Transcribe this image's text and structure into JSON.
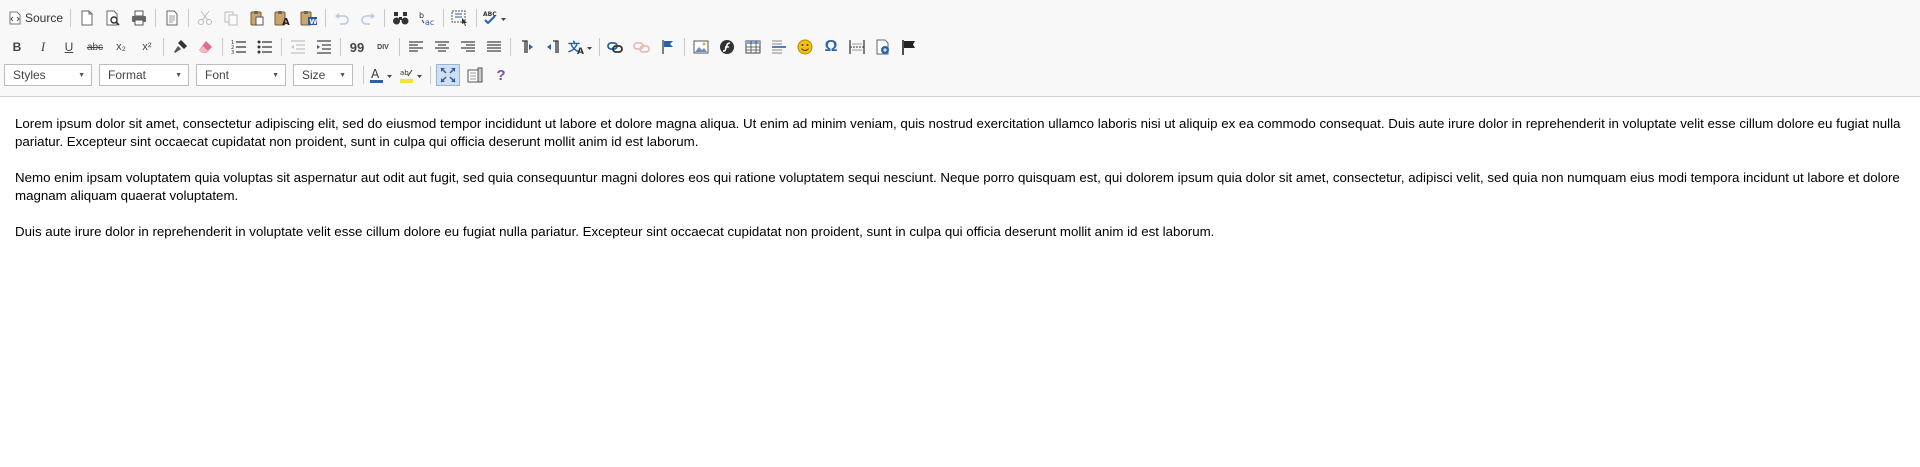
{
  "toolbar": {
    "source_label": "Source",
    "combos": {
      "styles": "Styles",
      "format": "Format",
      "font": "Font",
      "size": "Size"
    },
    "glyphs": {
      "bold": "B",
      "italic": "I",
      "underline": "U",
      "strike": "abc",
      "subscript": "x₂",
      "superscript": "x²",
      "blockquote": "99",
      "div": "DIV",
      "omega": "Ω",
      "help": "?"
    },
    "colors": {
      "accent": "#2b61a6",
      "text_color_swatch": "#2b61a6",
      "highlight_swatch": "#f3e23a",
      "flag": "#222222"
    }
  },
  "content": {
    "paragraphs": [
      "Lorem ipsum dolor sit amet, consectetur adipiscing elit, sed do eiusmod tempor incididunt ut labore et dolore magna aliqua. Ut enim ad minim veniam, quis nostrud exercitation ullamco laboris nisi ut aliquip ex ea commodo consequat. Duis aute irure dolor in reprehenderit in voluptate velit esse cillum dolore eu fugiat nulla pariatur. Excepteur sint occaecat cupidatat non proident, sunt in culpa qui officia deserunt mollit anim id est laborum.",
      "Nemo enim ipsam voluptatem quia voluptas sit aspernatur aut odit aut fugit, sed quia consequuntur magni dolores eos qui ratione voluptatem sequi nesciunt. Neque porro quisquam est, qui dolorem ipsum quia dolor sit amet, consectetur, adipisci velit, sed quia non numquam eius modi tempora incidunt ut labore et dolore magnam aliquam quaerat voluptatem.",
      "Duis aute irure dolor in reprehenderit in voluptate velit esse cillum dolore eu fugiat nulla pariatur. Excepteur sint occaecat cupidatat non proident, sunt in culpa qui officia deserunt mollit anim id est laborum."
    ]
  }
}
